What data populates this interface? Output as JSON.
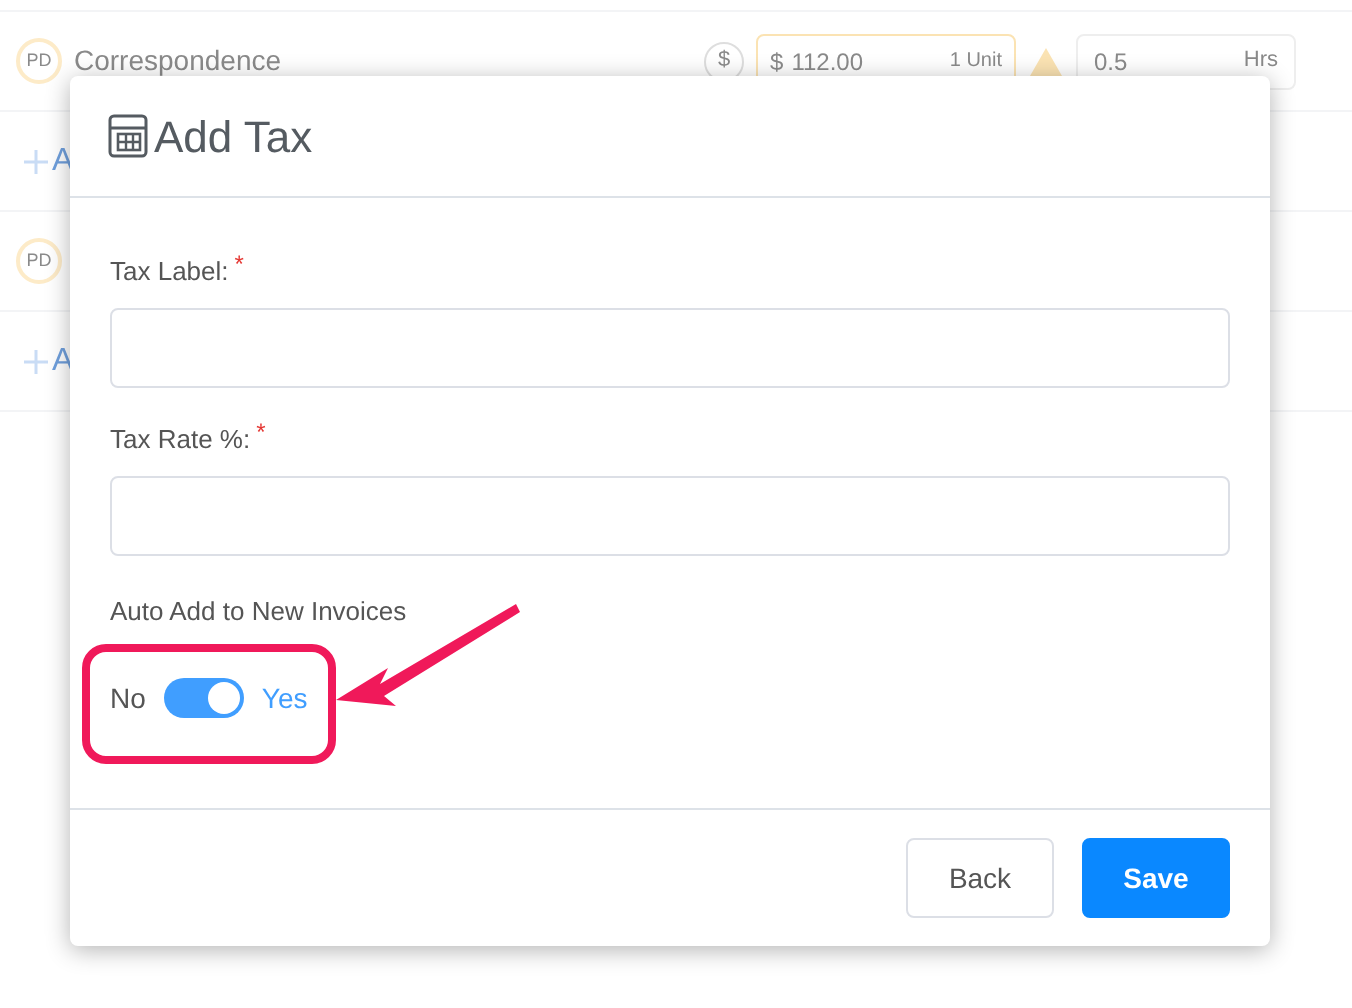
{
  "background": {
    "rows": [
      {
        "kind": "task",
        "avatar": "PD",
        "title": "Correspondence",
        "currency": "$",
        "amount": "112.00",
        "unit": "1 Unit",
        "hours": "0.5",
        "hours_unit": "Hrs"
      },
      {
        "kind": "add",
        "label": "A"
      },
      {
        "kind": "task",
        "avatar": "PD"
      },
      {
        "kind": "add",
        "label": "A"
      }
    ]
  },
  "dialog": {
    "title": "Add Tax",
    "fields": [
      {
        "label": "Tax Label:",
        "required_mark": "*"
      },
      {
        "label": "Tax Rate %:",
        "required_mark": "*"
      }
    ],
    "toggle": {
      "label": "Auto Add to New Invoices",
      "off_label": "No",
      "on_label": "Yes",
      "on": true
    },
    "buttons": [
      {
        "label": "Back",
        "kind": "secondary"
      },
      {
        "label": "Save",
        "kind": "primary"
      }
    ]
  }
}
